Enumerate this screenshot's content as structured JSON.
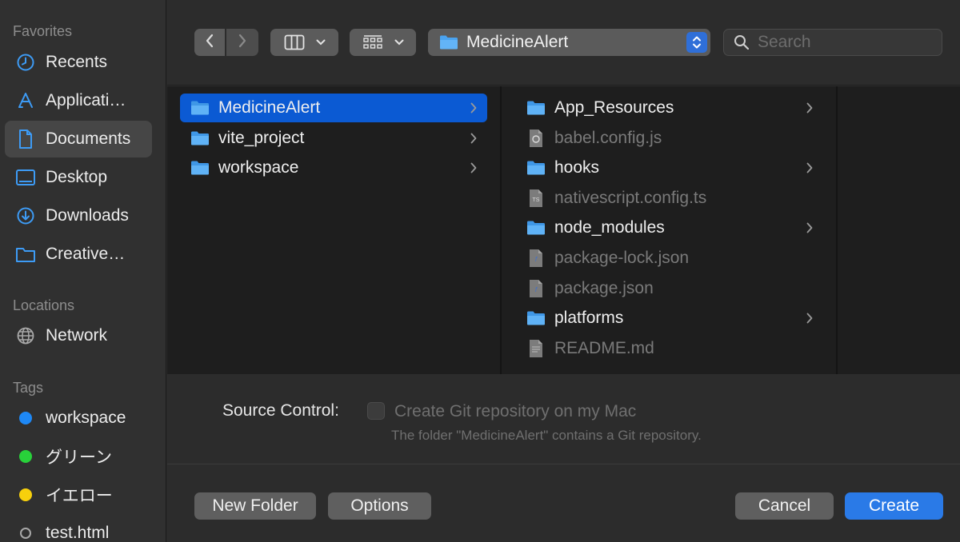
{
  "sidebar": {
    "favorites_title": "Favorites",
    "favorites": [
      {
        "label": "Recents",
        "icon": "clock-icon"
      },
      {
        "label": "Applicati…",
        "icon": "applications-icon"
      },
      {
        "label": "Documents",
        "icon": "document-icon"
      },
      {
        "label": "Desktop",
        "icon": "desktop-icon"
      },
      {
        "label": "Downloads",
        "icon": "download-icon"
      },
      {
        "label": "Creative…",
        "icon": "folder-icon"
      }
    ],
    "locations_title": "Locations",
    "locations": [
      {
        "label": "Network",
        "icon": "globe-icon"
      }
    ],
    "tags_title": "Tags",
    "tags": [
      {
        "label": "workspace",
        "color": "#1e88f5"
      },
      {
        "label": "グリーン",
        "color": "#28d13a"
      },
      {
        "label": "イエロー",
        "color": "#f7d00c"
      },
      {
        "label": "test.html",
        "color": "none"
      }
    ]
  },
  "toolbar": {
    "path_label": "MedicineAlert",
    "search_placeholder": "Search"
  },
  "browser": {
    "column1": [
      {
        "name": "MedicineAlert",
        "type": "folder",
        "has_children": true,
        "selected": true
      },
      {
        "name": "vite_project",
        "type": "folder",
        "has_children": true
      },
      {
        "name": "workspace",
        "type": "folder",
        "has_children": true
      }
    ],
    "column2": [
      {
        "name": "App_Resources",
        "type": "folder",
        "has_children": true
      },
      {
        "name": "babel.config.js",
        "type": "file-js"
      },
      {
        "name": "hooks",
        "type": "folder",
        "has_children": true
      },
      {
        "name": "nativescript.config.ts",
        "type": "file-ts"
      },
      {
        "name": "node_modules",
        "type": "folder",
        "has_children": true
      },
      {
        "name": "package-lock.json",
        "type": "file-json"
      },
      {
        "name": "package.json",
        "type": "file-json"
      },
      {
        "name": "platforms",
        "type": "folder",
        "has_children": true
      },
      {
        "name": "README.md",
        "type": "file-md"
      }
    ]
  },
  "source_control": {
    "label": "Source Control:",
    "checkbox_label": "Create Git repository on my Mac",
    "note": "The folder \"MedicineAlert\" contains a Git repository."
  },
  "buttons": {
    "new_folder": "New Folder",
    "options": "Options",
    "cancel": "Cancel",
    "create": "Create"
  },
  "colors": {
    "accent": "#0b5ad3",
    "primary_button": "#2a7ae7",
    "folder": "#4aa3f0"
  }
}
